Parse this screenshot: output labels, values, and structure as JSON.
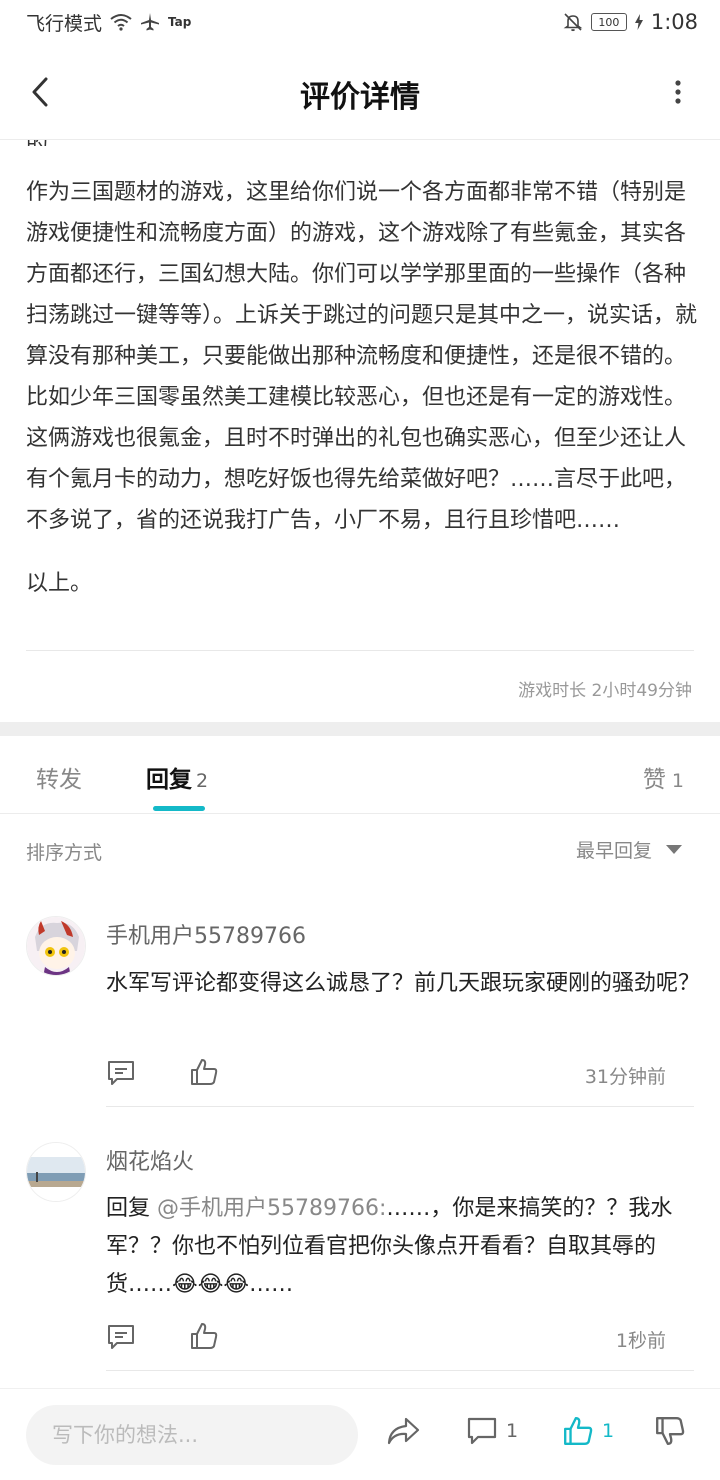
{
  "status": {
    "mode": "飞行模式",
    "tap": "Tap",
    "battery": "100",
    "time": "1:08"
  },
  "header": {
    "title": "评价详情"
  },
  "review": {
    "cut_line": "的……",
    "paragraph": "作为三国题材的游戏，这里给你们说一个各方面都非常不错（特别是游戏便捷性和流畅度方面）的游戏，这个游戏除了有些氪金，其实各方面都还行，三国幻想大陆。你们可以学学那里面的一些操作（各种扫荡跳过一键等等）。上诉关于跳过的问题只是其中之一，说实话，就算没有那种美工，只要能做出那种流畅度和便捷性，还是很不错的。比如少年三国零虽然美工建模比较恶心，但也还是有一定的游戏性。这俩游戏也很氪金，且时不时弹出的礼包也确实恶心，但至少还让人有个氪月卡的动力，想吃好饭也得先给菜做好吧？……言尽于此吧，不多说了，省的还说我打广告，小厂不易，且行且珍惜吧……",
    "closing": "以上。",
    "play_time": "游戏时长 2小时49分钟"
  },
  "tabs": {
    "forward": "转发",
    "reply": "回复",
    "reply_count": "2",
    "like": "赞",
    "like_count": "1"
  },
  "sort": {
    "label": "排序方式",
    "value": "最早回复"
  },
  "comments": [
    {
      "name": "手机用户55789766",
      "text": "水军写评论都变得这么诚恳了？前几天跟玩家硬刚的骚劲呢？",
      "time": "31分钟前"
    },
    {
      "name": "烟花焰火",
      "reply_prefix": "回复 ",
      "mention": "@手机用户55789766:",
      "text": "……，你是来搞笑的？？我水军？？你也不怕列位看官把你头像点开看看？自取其辱的货……😂😂😂……",
      "time": "1秒前"
    }
  ],
  "bottom": {
    "placeholder": "写下你的想法...",
    "comment_count": "1",
    "like_count": "1"
  },
  "colors": {
    "accent": "#14b9c8",
    "muted_text": "#888888",
    "divider": "#e8e8e8"
  }
}
